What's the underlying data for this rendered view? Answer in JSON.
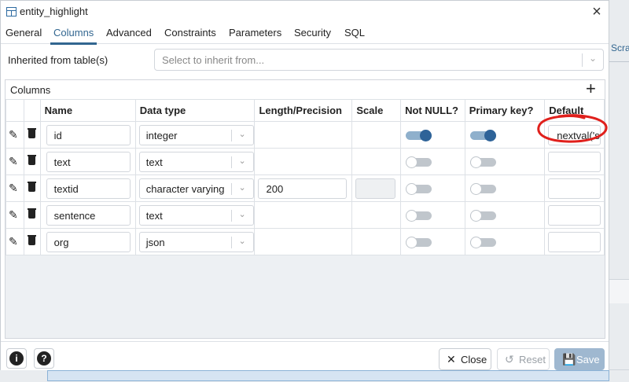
{
  "window": {
    "title": "entity_highlight",
    "close_symbol": "×"
  },
  "tabs": [
    {
      "label": "General"
    },
    {
      "label": "Columns",
      "active": true
    },
    {
      "label": "Advanced"
    },
    {
      "label": "Constraints"
    },
    {
      "label": "Parameters"
    },
    {
      "label": "Security"
    },
    {
      "label": "SQL"
    }
  ],
  "inherit": {
    "label": "Inherited from table(s)",
    "placeholder": "Select to inherit from..."
  },
  "columns_panel": {
    "title": "Columns",
    "add_symbol": "+",
    "headers": [
      "Name",
      "Data type",
      "Length/Precision",
      "Scale",
      "Not NULL?",
      "Primary key?",
      "Default"
    ],
    "rows": [
      {
        "name": "id",
        "data_type": "integer",
        "length": "",
        "scale": "",
        "not_null": true,
        "primary_key": true,
        "default": "nextval('s"
      },
      {
        "name": "text",
        "data_type": "text",
        "length": "",
        "scale": "",
        "not_null": false,
        "primary_key": false,
        "default": ""
      },
      {
        "name": "textid",
        "data_type": "character varying",
        "length": "200",
        "scale": "",
        "not_null": false,
        "primary_key": false,
        "default": ""
      },
      {
        "name": "sentence",
        "data_type": "text",
        "length": "",
        "scale": "",
        "not_null": false,
        "primary_key": false,
        "default": ""
      },
      {
        "name": "org",
        "data_type": "json",
        "length": "",
        "scale": "",
        "not_null": false,
        "primary_key": false,
        "default": ""
      }
    ]
  },
  "footer": {
    "info_symbol": "i",
    "help_symbol": "?",
    "close_label": "Close",
    "reset_label": "Reset",
    "save_label": "Save"
  },
  "background": {
    "right_tab_label": "Scra"
  },
  "colors": {
    "accent": "#326690",
    "toggle_on": "#2e6398",
    "annotation": "#e0201c"
  }
}
